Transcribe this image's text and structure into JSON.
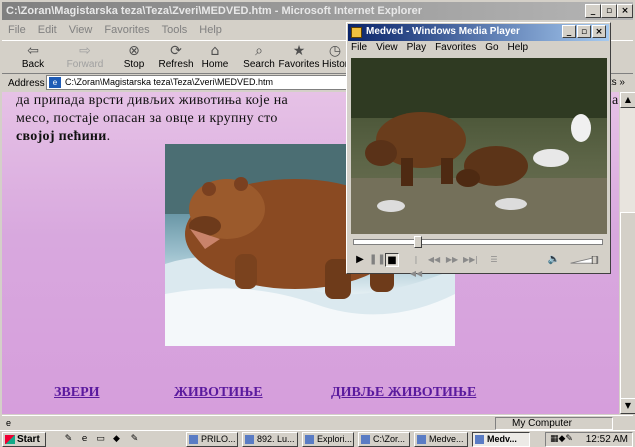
{
  "ie": {
    "title": "C:\\Zoran\\Magistarska teza\\Teza\\Zveri\\MEDVED.htm - Microsoft Internet Explorer",
    "menu": [
      "File",
      "Edit",
      "View",
      "Favorites",
      "Tools",
      "Help"
    ],
    "toolbar": {
      "back": "Back",
      "forward": "Forward",
      "stop": "Stop",
      "refresh": "Refresh",
      "home": "Home",
      "search": "Search",
      "favorites": "Favorites",
      "history": "Histor"
    },
    "address_label": "Address",
    "address_value": "C:\\Zoran\\Magistarska teza\\Teza\\Zveri\\MEDVED.htm",
    "links_label": "nks »",
    "status_zone": "My Computer"
  },
  "content": {
    "line1": "да припада врсти дивљих животиња које на",
    "line1_end": "a",
    "line2": "месо, постаје опасан за овце и крупну сто",
    "line3_bold": "својој пећини",
    "line3_rest": ".",
    "links": [
      "ЗВЕРИ",
      "ЖИВОТИЊЕ",
      "ДИВЉЕ ЖИВОТИЊЕ"
    ]
  },
  "wmp": {
    "title": "Medved - Windows Media Player",
    "menu": [
      "File",
      "View",
      "Play",
      "Favorites",
      "Go",
      "Help"
    ],
    "seek_position_fraction": 0.25
  },
  "taskbar": {
    "start": "Start",
    "tasks": [
      "PRILO...",
      "892. Lu...",
      "Explori...",
      "C:\\Zor...",
      "Medve...",
      "Medv..."
    ],
    "clock": "12:52 AM"
  },
  "colors": {
    "page_bg": "#d8a8de",
    "link": "#5a1a9e",
    "wmp_title": "#0a246a"
  }
}
